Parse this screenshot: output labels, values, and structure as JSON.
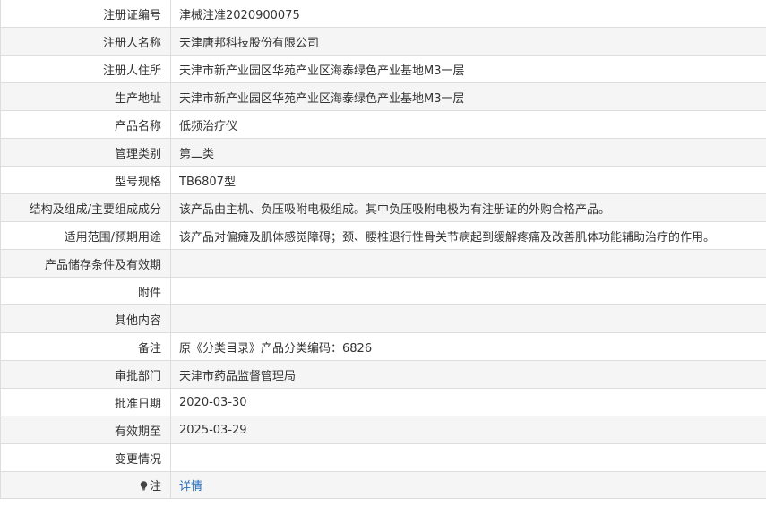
{
  "rows": [
    {
      "label": "注册证编号",
      "value": "津械注准2020900075"
    },
    {
      "label": "注册人名称",
      "value": "天津唐邦科技股份有限公司"
    },
    {
      "label": "注册人住所",
      "value": "天津市新产业园区华苑产业区海泰绿色产业基地M3一层"
    },
    {
      "label": "生产地址",
      "value": "天津市新产业园区华苑产业区海泰绿色产业基地M3一层"
    },
    {
      "label": "产品名称",
      "value": "低频治疗仪"
    },
    {
      "label": "管理类别",
      "value": "第二类"
    },
    {
      "label": "型号规格",
      "value": "TB6807型"
    },
    {
      "label": "结构及组成/主要组成成分",
      "value": "该产品由主机、负压吸附电极组成。其中负压吸附电极为有注册证的外购合格产品。"
    },
    {
      "label": "适用范围/预期用途",
      "value": "该产品对偏瘫及肌体感觉障碍；颈、腰椎退行性骨关节病起到缓解疼痛及改善肌体功能辅助治疗的作用。"
    },
    {
      "label": "产品储存条件及有效期",
      "value": ""
    },
    {
      "label": "附件",
      "value": ""
    },
    {
      "label": "其他内容",
      "value": ""
    },
    {
      "label": "备注",
      "value": "原《分类目录》产品分类编码：6826"
    },
    {
      "label": "审批部门",
      "value": "天津市药品监督管理局"
    },
    {
      "label": "批准日期",
      "value": "2020-03-30"
    },
    {
      "label": "有效期至",
      "value": "2025-03-29"
    },
    {
      "label": "变更情况",
      "value": ""
    }
  ],
  "note": {
    "icon": "lightbulb-icon",
    "label": "注",
    "link_text": "详情"
  },
  "colors": {
    "border": "#dddddd",
    "stripe": "#f5f5f5",
    "text": "#333333",
    "link": "#2a6ebb"
  }
}
